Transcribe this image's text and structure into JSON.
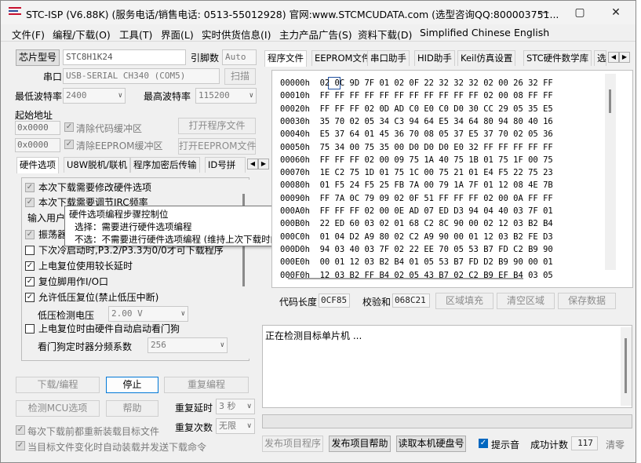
{
  "window": {
    "title": "STC-ISP (V6.88K) (服务电话/销售电话: 0513-55012928) 官网:www.STCMCUDATA.com  (选型咨询QQ:800003751...",
    "minimize_icon": "minimize-icon",
    "maximize_icon": "maximize-icon",
    "close_icon": "close-icon"
  },
  "menu": [
    "文件(F)",
    "编程/下载(O)",
    "工具(T)",
    "界面(L)",
    "实时供货信息(I)",
    "主力产品广告(S)",
    "资料下载(D)",
    "Simplified Chinese",
    "English"
  ],
  "left": {
    "chip_model_btn": "芯片型号",
    "chip_model_value": "STC8H1K24",
    "pin_label": "引脚数",
    "pin_value": "Auto",
    "port_label": "串口",
    "port_value": "USB-SERIAL CH340 (COM5)",
    "scan_btn": "扫描",
    "min_baud_label": "最低波特率",
    "min_baud_value": "2400",
    "max_baud_label": "最高波特率",
    "max_baud_value": "115200",
    "start_addr_label": "起始地址",
    "addr1": "0x0000",
    "clear_code_buf": "清除代码缓冲区",
    "open_prog_btn": "打开程序文件",
    "addr2": "0x0000",
    "clear_eeprom_buf": "清除EEPROM缓冲区",
    "open_eeprom_btn": "打开EEPROM文件",
    "tabs": [
      "硬件选项",
      "U8W脱机/联机",
      "程序加密后传输",
      "ID号拼"
    ],
    "options": {
      "opt1": "本次下载需要修改硬件选项",
      "opt2": "本次下载需要调节IRC频率",
      "opt3": "输入用户",
      "opt4": "振荡器",
      "opt5": "下次冷启动时,P3.2/P3.3为0/0才可下载程序",
      "opt6": "上电复位使用较长延时",
      "opt7": "复位脚用作I/O口",
      "opt8": "允许低压复位(禁止低压中断)",
      "opt9_label": "低压检测电压",
      "opt9_value": "2.00 V",
      "opt10": "上电复位时由硬件自动启动看门狗",
      "opt11_label": "看门狗定时器分频系数",
      "opt11_value": "256"
    },
    "tooltip": {
      "line1": "硬件选项编程步骤控制位",
      "line2": "选择：需要进行硬件选项编程",
      "line3": "不选：不需要进行硬件选项编程 (维持上次下载时的设置)"
    },
    "download_btn": "下载/编程",
    "stop_btn": "停止",
    "reprogram_btn": "重复编程",
    "detect_btn": "检测MCU选项",
    "help_btn": "帮助",
    "repeat_delay_label": "重复延时",
    "repeat_delay_value": "3 秒",
    "repeat_count_label": "重复次数",
    "repeat_count_value": "无限",
    "reload_before": "每次下载前都重新装载目标文件",
    "auto_load": "当目标文件变化时自动装载并发送下载命令"
  },
  "right": {
    "tabs": [
      "程序文件",
      "EEPROM文件",
      "串口助手",
      "HID助手",
      "Keil仿真设置",
      "STC硬件数学库",
      "选"
    ],
    "hex_rows": [
      {
        "addr": "00000h",
        "bytes": "02 0C 9D 7F 01 02 0F 22 32 32 32 02 00 26 32 FF"
      },
      {
        "addr": "00010h",
        "bytes": "FF FF FF FF FF FF FF FF FF FF FF 02 00 08 FF FF"
      },
      {
        "addr": "00020h",
        "bytes": "FF FF FF 02 0D AD C0 E0 C0 D0 30 CC 29 05 35 E5"
      },
      {
        "addr": "00030h",
        "bytes": "35 70 02 05 34 C3 94 64 E5 34 64 80 94 80 40 16"
      },
      {
        "addr": "00040h",
        "bytes": "E5 37 64 01 45 36 70 08 05 37 E5 37 70 02 05 36"
      },
      {
        "addr": "00050h",
        "bytes": "75 34 00 75 35 00 D0 D0 D0 E0 32 FF FF FF FF FF"
      },
      {
        "addr": "00060h",
        "bytes": "FF FF FF 02 00 09 75 1A 40 75 1B 01 75 1F 00 75"
      },
      {
        "addr": "00070h",
        "bytes": "1E C2 75 1D 01 75 1C 00 75 21 01 E4 F5 22 75 23"
      },
      {
        "addr": "00080h",
        "bytes": "01 F5 24 F5 25 FB 7A 00 79 1A 7F 01 12 08 4E 7B"
      },
      {
        "addr": "00090h",
        "bytes": "FF 7A 0C 79 09 02 0F 51 FF FF FF 02 00 0A FF FF"
      },
      {
        "addr": "000A0h",
        "bytes": "FF FF FF 02 00 0E AD 07 ED D3 94 04 40 03 7F 01"
      },
      {
        "addr": "000B0h",
        "bytes": "22 ED 60 03 02 01 68 C2 8C 90 00 02 12 03 B2 B4"
      },
      {
        "addr": "000C0h",
        "bytes": "01 04 D2 A9 80 02 C2 A9 90 00 01 12 03 B2 FE D3"
      },
      {
        "addr": "000D0h",
        "bytes": "94 03 40 03 7F 02 22 EE 70 05 53 B7 FD C2 B9 90"
      },
      {
        "addr": "000E0h",
        "bytes": "00 01 12 03 B2 B4 01 05 53 B7 FD D2 B9 90 00 01"
      },
      {
        "addr": "000F0h",
        "bytes": "12 03 B2 FF B4 02 05 43 B7 02 C2 B9 EF B4 03 05"
      }
    ],
    "code_len_label": "代码长度",
    "code_len_value": "0CF85",
    "checksum_label": "校验和",
    "checksum_value": "068C21",
    "fill_btn": "区域填充",
    "clear_btn": "清空区域",
    "save_btn": "保存数据",
    "log_text": "正在检测目标单片机 ...",
    "publish_btn": "发布项目程序",
    "publish_help_btn": "发布项目帮助",
    "read_disk_btn": "读取本机硬盘号",
    "beep_label": "提示音",
    "success_label": "成功计数",
    "success_value": "117",
    "clear_count_btn": "清零"
  }
}
